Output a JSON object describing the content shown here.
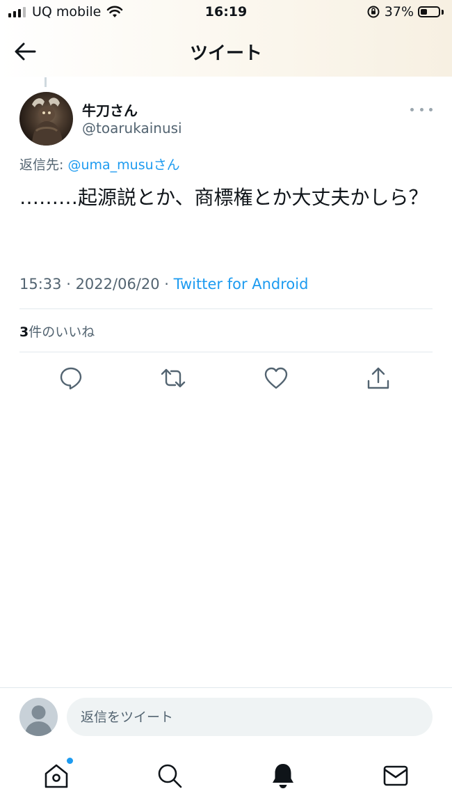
{
  "status_bar": {
    "carrier": "UQ mobile",
    "time": "16:19",
    "battery_percent": "37%",
    "battery_level": 0.37
  },
  "header": {
    "title": "ツイート",
    "back_icon": "arrow-left-icon"
  },
  "tweet": {
    "author_name": "牛刀さん",
    "author_handle": "@toarukainusi",
    "reply_to_label": "返信先: ",
    "reply_to_mention": "@uma_musuさん",
    "text": "………起源説とか、商標権とか大丈夫かしら？",
    "time": "15:33",
    "date": "2022/06/20",
    "separator": " · ",
    "source": "Twitter for Android",
    "likes_count": "3",
    "likes_label": "件のいいね"
  },
  "actions": [
    {
      "name": "reply-action",
      "icon": "comment-icon"
    },
    {
      "name": "retweet-action",
      "icon": "retweet-icon"
    },
    {
      "name": "like-action",
      "icon": "heart-icon"
    },
    {
      "name": "share-action",
      "icon": "share-icon"
    }
  ],
  "reply_bar": {
    "placeholder": "返信をツイート"
  },
  "tab_bar": [
    {
      "name": "home",
      "icon": "home-icon",
      "has_notification_dot": true
    },
    {
      "name": "search",
      "icon": "search-icon"
    },
    {
      "name": "notifications",
      "icon": "bell-icon"
    },
    {
      "name": "messages",
      "icon": "mail-icon"
    }
  ],
  "colors": {
    "accent": "#1d9bf0",
    "text_primary": "#0f1419",
    "text_secondary": "#536471",
    "divider": "#e1e8ed"
  }
}
